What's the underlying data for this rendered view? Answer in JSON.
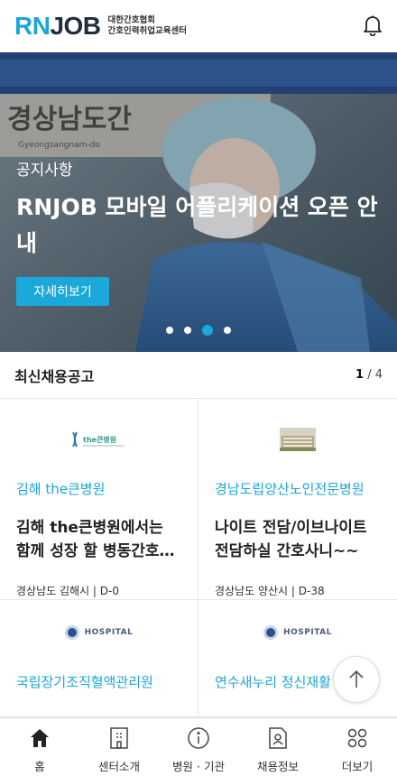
{
  "header": {
    "logo_rn": "RN",
    "logo_job": "JOB",
    "logo_line1": "대한간호협회",
    "logo_line2": "간호인력취업교육센터",
    "bell_icon": "bell-icon"
  },
  "banner": {
    "category": "공지사항",
    "title": "RNJOB 모바일 어플리케이션 오픈 안내",
    "button_label": "자세히보기",
    "slide_count": 4,
    "active_slide": 3,
    "background_signage": "경상남도간",
    "background_romanized": "Gyeongsangnam-do",
    "accent_color": "#1ba9dc"
  },
  "jobs": {
    "section_title": "최신채용공고",
    "page_current": "1",
    "page_total": "/ 4",
    "cards": [
      {
        "logo_text": "the큰병원",
        "org": "김해 the큰병원",
        "title": "김해 the큰병원에서는 함께 성장 할 병동간호…",
        "meta": "경상남도 김해시 | D-0"
      },
      {
        "logo_text": "",
        "org": "경남도립양산노인전문병원",
        "title": "나이트 전담/이브나이트 전담하실 간호사니~~",
        "meta": "경상남도 양산시 | D-38"
      },
      {
        "logo_text": "HOSPITAL",
        "org": "국립장기조직혈액관리원",
        "title": "",
        "meta": ""
      },
      {
        "logo_text": "HOSPITAL",
        "org": "연수새누리 정신재활",
        "title": "",
        "meta": ""
      }
    ]
  },
  "scroll_top": {
    "icon": "arrow-up-icon"
  },
  "nav": {
    "items": [
      {
        "label": "홈",
        "icon": "home-icon"
      },
      {
        "label": "센터소개",
        "icon": "building-icon"
      },
      {
        "label": "병원 · 기관",
        "icon": "info-icon"
      },
      {
        "label": "채용정보",
        "icon": "document-person-icon"
      },
      {
        "label": "더보기",
        "icon": "more-grid-icon"
      }
    ]
  }
}
